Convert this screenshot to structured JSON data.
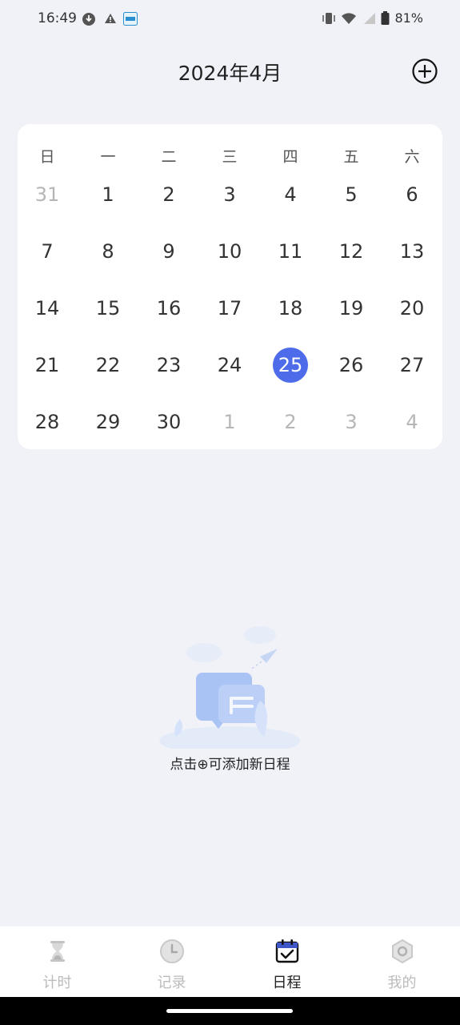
{
  "status": {
    "time": "16:49",
    "battery": "81%"
  },
  "header": {
    "title": "2024年4月",
    "add_icon": "plus-circle-icon"
  },
  "calendar": {
    "weekdays": [
      "日",
      "一",
      "二",
      "三",
      "四",
      "五",
      "六"
    ],
    "weeks": [
      [
        {
          "d": "31",
          "m": true
        },
        {
          "d": "1"
        },
        {
          "d": "2"
        },
        {
          "d": "3"
        },
        {
          "d": "4"
        },
        {
          "d": "5"
        },
        {
          "d": "6"
        }
      ],
      [
        {
          "d": "7"
        },
        {
          "d": "8"
        },
        {
          "d": "9"
        },
        {
          "d": "10"
        },
        {
          "d": "11"
        },
        {
          "d": "12"
        },
        {
          "d": "13"
        }
      ],
      [
        {
          "d": "14"
        },
        {
          "d": "15"
        },
        {
          "d": "16"
        },
        {
          "d": "17"
        },
        {
          "d": "18"
        },
        {
          "d": "19"
        },
        {
          "d": "20"
        }
      ],
      [
        {
          "d": "21"
        },
        {
          "d": "22"
        },
        {
          "d": "23"
        },
        {
          "d": "24"
        },
        {
          "d": "25",
          "sel": true
        },
        {
          "d": "26"
        },
        {
          "d": "27"
        }
      ],
      [
        {
          "d": "28"
        },
        {
          "d": "29"
        },
        {
          "d": "30"
        },
        {
          "d": "1",
          "m": true
        },
        {
          "d": "2",
          "m": true
        },
        {
          "d": "3",
          "m": true
        },
        {
          "d": "4",
          "m": true
        }
      ]
    ],
    "selected_color": "#4e6ce9"
  },
  "empty": {
    "text": "点击⊕可添加新日程"
  },
  "tabs": [
    {
      "label": "计时",
      "icon": "hourglass-icon"
    },
    {
      "label": "记录",
      "icon": "clock-icon"
    },
    {
      "label": "日程",
      "icon": "calendar-check-icon",
      "active": true
    },
    {
      "label": "我的",
      "icon": "hexagon-settings-icon"
    }
  ]
}
